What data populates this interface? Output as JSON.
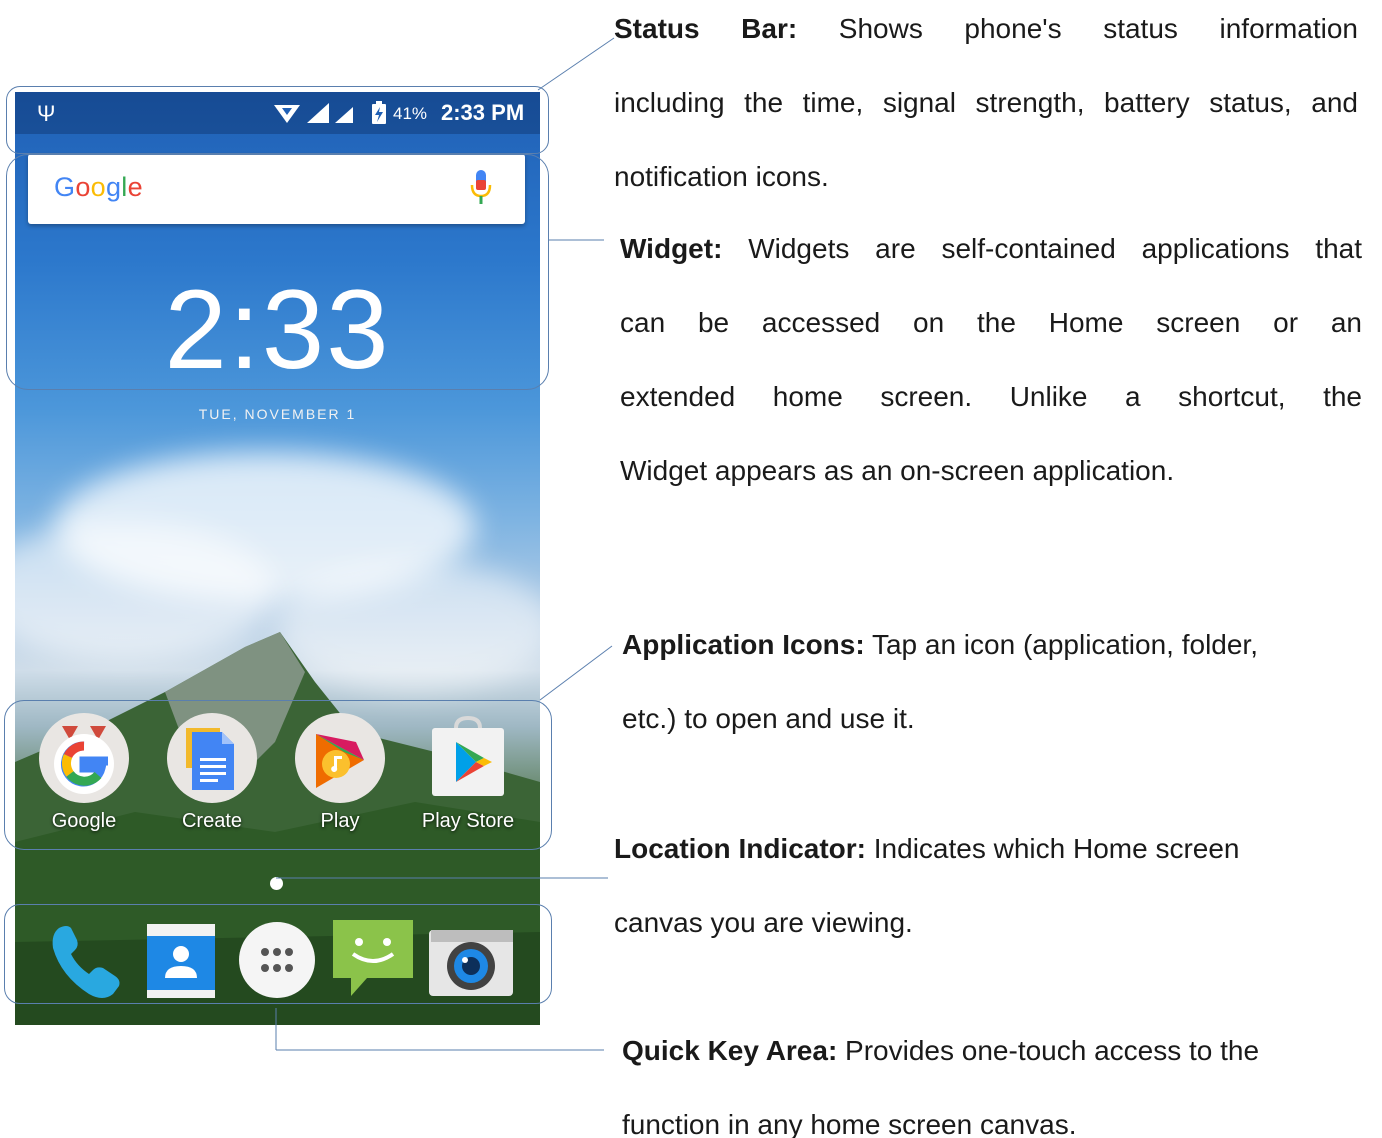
{
  "status_bar": {
    "battery": "41%",
    "time": "2:33 PM"
  },
  "search": {
    "logo_letters": [
      "G",
      "o",
      "o",
      "g",
      "l",
      "e"
    ],
    "logo_colors": [
      "#4285F4",
      "#EA4335",
      "#FBBC05",
      "#4285F4",
      "#34A853",
      "#EA4335"
    ]
  },
  "clock": {
    "time": "2:33",
    "date": "TUE, NOVEMBER 1"
  },
  "apps": [
    {
      "label": "Google",
      "icon": "google-g-icon"
    },
    {
      "label": "Create",
      "icon": "docs-icon"
    },
    {
      "label": "Play",
      "icon": "play-music-icon"
    },
    {
      "label": "Play Store",
      "icon": "play-store-icon"
    }
  ],
  "dock": [
    {
      "icon": "phone-icon"
    },
    {
      "icon": "contacts-icon"
    },
    {
      "icon": "app-drawer-icon"
    },
    {
      "icon": "messaging-icon"
    },
    {
      "icon": "camera-icon"
    }
  ],
  "descriptions": {
    "status_bar": {
      "title": "Status Bar:",
      "lines": [
        " Shows phone's status information",
        "including the time, signal strength, battery status, and",
        "notification icons."
      ]
    },
    "widget": {
      "title": "Widget:",
      "lines": [
        " Widgets are self-contained applications that",
        "can be accessed on the Home screen or an",
        "extended home screen. Unlike a shortcut, the",
        "Widget appears as an on-screen application."
      ]
    },
    "app_icons": {
      "title": "Application Icons:",
      "lines": [
        " Tap an icon (application, folder,",
        "etc.) to open and use it."
      ]
    },
    "location": {
      "title": "Location Indicator:",
      "lines": [
        " Indicates which Home screen",
        "canvas you are viewing."
      ]
    },
    "quick_key": {
      "title": "Quick Key Area:",
      "lines": [
        " Provides one-touch access to the",
        "function in any home screen canvas."
      ]
    }
  },
  "colors": {
    "frame": "#5a7fae",
    "wallpaper_sky": "#2c78cc",
    "wallpaper_forest": "#2f5a2a"
  }
}
